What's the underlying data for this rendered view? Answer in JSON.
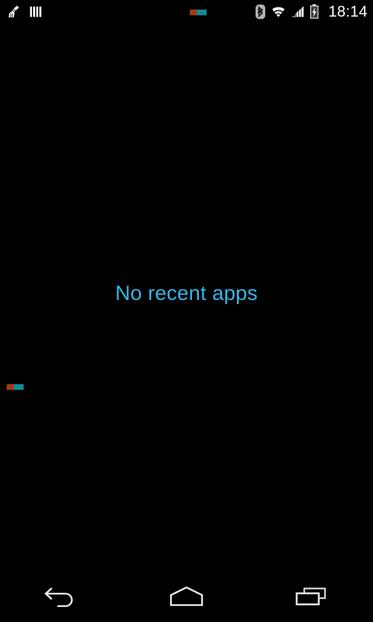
{
  "screen": {
    "name": "android-recents",
    "background_color": "#000000"
  },
  "status_bar": {
    "clock": "18:14",
    "left_icons": [
      {
        "name": "broom-cleaner-icon",
        "label": "Cleaner notification"
      },
      {
        "name": "barcode-icon",
        "label": "Barcode scanner notification"
      }
    ],
    "center_icons": [
      {
        "name": "orange-teal-indicator-icon",
        "label": "Dual color status indicator"
      }
    ],
    "right_icons": [
      {
        "name": "bluetooth-icon",
        "label": "Bluetooth on"
      },
      {
        "name": "wifi-icon",
        "label": "Wi-Fi full signal"
      },
      {
        "name": "cell-signal-icon",
        "label": "Mobile signal"
      },
      {
        "name": "battery-charging-icon",
        "label": "Battery charging"
      }
    ],
    "colors": {
      "text": "#ffffff",
      "icon": "#ffffff",
      "background": "#000000"
    }
  },
  "recents": {
    "empty_message": "No recent apps",
    "empty_message_color": "#33b5e5",
    "floating_indicator": {
      "name": "orange-teal-indicator-icon",
      "label": "Dual color status indicator"
    }
  },
  "nav_bar": {
    "buttons": [
      {
        "name": "back-button",
        "label": "Back"
      },
      {
        "name": "home-button",
        "label": "Home"
      },
      {
        "name": "recents-button",
        "label": "Recent apps"
      }
    ],
    "icon_color": "#e8e8e8"
  }
}
